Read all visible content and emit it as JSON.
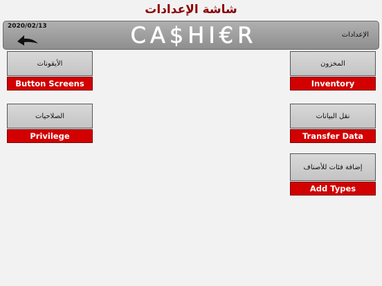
{
  "screen_title": "شاشة الإعدادات",
  "header": {
    "date": "2020/02/13",
    "logo": "CA$HI€R",
    "section": "الإعدادات",
    "back_icon": "back-arrow-icon"
  },
  "tiles": {
    "button_screens": {
      "ar": "الأيقونات",
      "en": "Button Screens"
    },
    "privilege": {
      "ar": "الصلاحيات",
      "en": "Privilege"
    },
    "inventory": {
      "ar": "المخزون",
      "en": "Inventory"
    },
    "transfer_data": {
      "ar": "نقل البيانات",
      "en": "Transfer Data"
    },
    "add_types": {
      "ar": "إضافة فئات للأصناف",
      "en": "Add Types"
    }
  },
  "colors": {
    "title": "#8b0000",
    "accent": "#d20000",
    "header": "#9e9e9e"
  }
}
